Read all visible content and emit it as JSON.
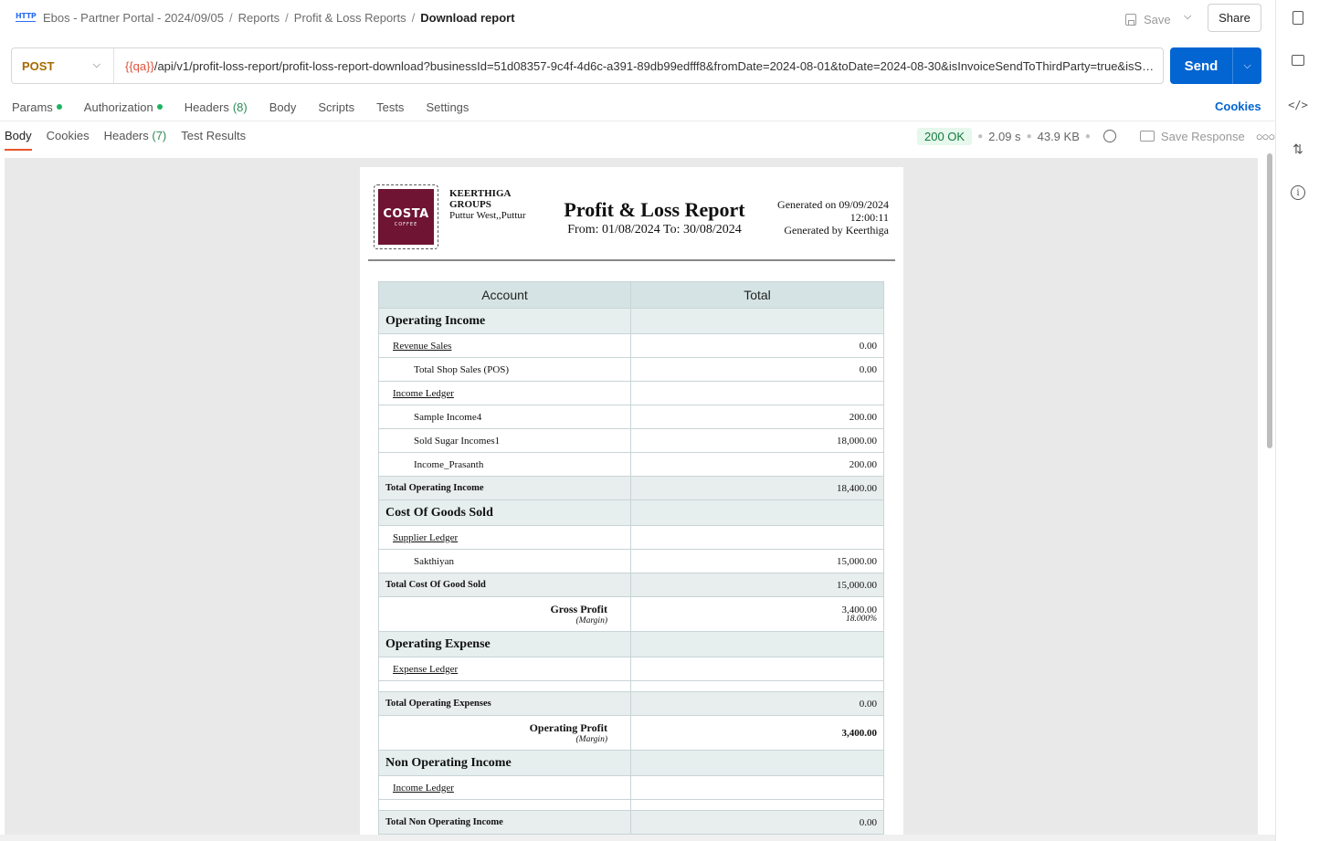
{
  "header": {
    "breadcrumb": [
      "Ebos - Partner Portal - 2024/09/05",
      "Reports",
      "Profit & Loss Reports"
    ],
    "current": "Download report",
    "save_label": "Save",
    "share_label": "Share"
  },
  "request": {
    "method": "POST",
    "url_var": "{{qa}}",
    "url_path": "/api/v1/profit-loss-report/profit-loss-report-download?businessId=51d08357-9c4f-4d6c-a391-89db99edfff8&fromDate=2024-08-01&toDate=2024-08-30&isInvoiceSendToThirdParty=true&isSomethingElse=false",
    "send_label": "Send",
    "tabs": {
      "params": "Params",
      "authorization": "Authorization",
      "headers": "Headers",
      "headers_count": "(8)",
      "body": "Body",
      "scripts": "Scripts",
      "tests": "Tests",
      "settings": "Settings"
    },
    "cookies_label": "Cookies"
  },
  "response": {
    "tabs": {
      "body": "Body",
      "cookies": "Cookies",
      "headers": "Headers",
      "headers_count": "(7)",
      "test_results": "Test Results"
    },
    "status": "200 OK",
    "time": "2.09 s",
    "size": "43.9 KB",
    "save_response": "Save Response"
  },
  "report": {
    "logo_text": "COSTA",
    "logo_sub": "COFFEE",
    "company_name": "KEERTHIGA GROUPS",
    "company_location": "Puttur West,,Puttur",
    "title": "Profit & Loss Report",
    "range": "From: 01/08/2024 To: 30/08/2024",
    "generated_on": "Generated on 09/09/2024",
    "generated_time": "12:00:11",
    "generated_by": "Generated by Keerthiga",
    "col_account": "Account",
    "col_total": "Total",
    "operating_income": {
      "title": "Operating Income",
      "revenue_label": "Revenue Sales",
      "revenue_value": "0.00",
      "shop_sales_label": "Total Shop Sales (POS)",
      "shop_sales_value": "0.00",
      "income_ledger_label": "Income Ledger",
      "items": [
        {
          "name": "Sample Income4",
          "value": "200.00"
        },
        {
          "name": "Sold Sugar Incomes1",
          "value": "18,000.00"
        },
        {
          "name": "Income_Prasanth",
          "value": "200.00"
        }
      ],
      "total_label": "Total Operating Income",
      "total_value": "18,400.00"
    },
    "cogs": {
      "title": "Cost Of Goods Sold",
      "supplier_ledger_label": "Supplier Ledger",
      "item_name": "Sakthiyan",
      "item_value": "15,000.00",
      "total_label": "Total Cost Of Good Sold",
      "total_value": "15,000.00"
    },
    "gross_profit": {
      "label": "Gross Profit",
      "margin_label": "(Margin)",
      "value": "3,400.00",
      "margin": "18.000%"
    },
    "operating_expense": {
      "title": "Operating Expense",
      "ledger_label": "Expense Ledger",
      "total_label": "Total Operating Expenses",
      "total_value": "0.00"
    },
    "operating_profit": {
      "label": "Operating Profit",
      "margin_label": "(Margin)",
      "value": "3,400.00"
    },
    "non_operating_income": {
      "title": "Non Operating Income",
      "ledger_label": "Income Ledger",
      "total_label": "Total Non Operating Income",
      "total_value": "0.00"
    }
  }
}
